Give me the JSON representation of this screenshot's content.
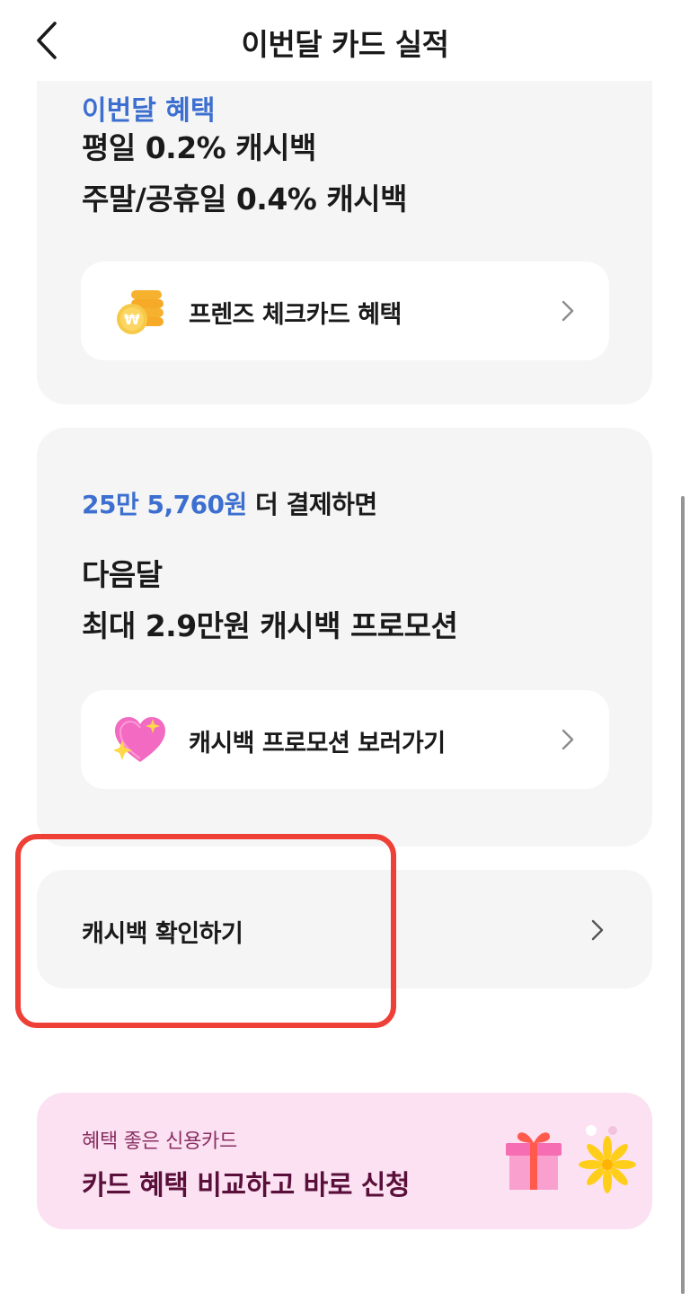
{
  "header": {
    "title": "이번달 카드 실적"
  },
  "card1": {
    "peek_text": "이번달 혜택",
    "line1": "평일 0.2% 캐시백",
    "line2": "주말/공휴일 0.4% 캐시백",
    "button": {
      "label": "프렌즈 체크카드 혜택",
      "icon": "coins-won-icon"
    }
  },
  "card2": {
    "amount": "25만 5,760원",
    "amount_suffix": " 더 결제하면",
    "line1": "다음달",
    "line2": "최대 2.9만원 캐시백 프로모션",
    "button": {
      "label": "캐시백 프로모션 보러가기",
      "icon": "sparkle-heart-icon"
    }
  },
  "card3": {
    "label": "캐시백 확인하기"
  },
  "promo": {
    "small_text": "혜택 좋은 신용카드",
    "title": "카드 혜택 비교하고 바로 신청",
    "icons": [
      "gift-icon",
      "sparkle-icon"
    ]
  },
  "colors": {
    "accent_blue": "#3c6fd0",
    "card_bg": "#f5f5f5",
    "highlight_red": "#ee4037",
    "promo_bg": "#fbe1f1"
  }
}
